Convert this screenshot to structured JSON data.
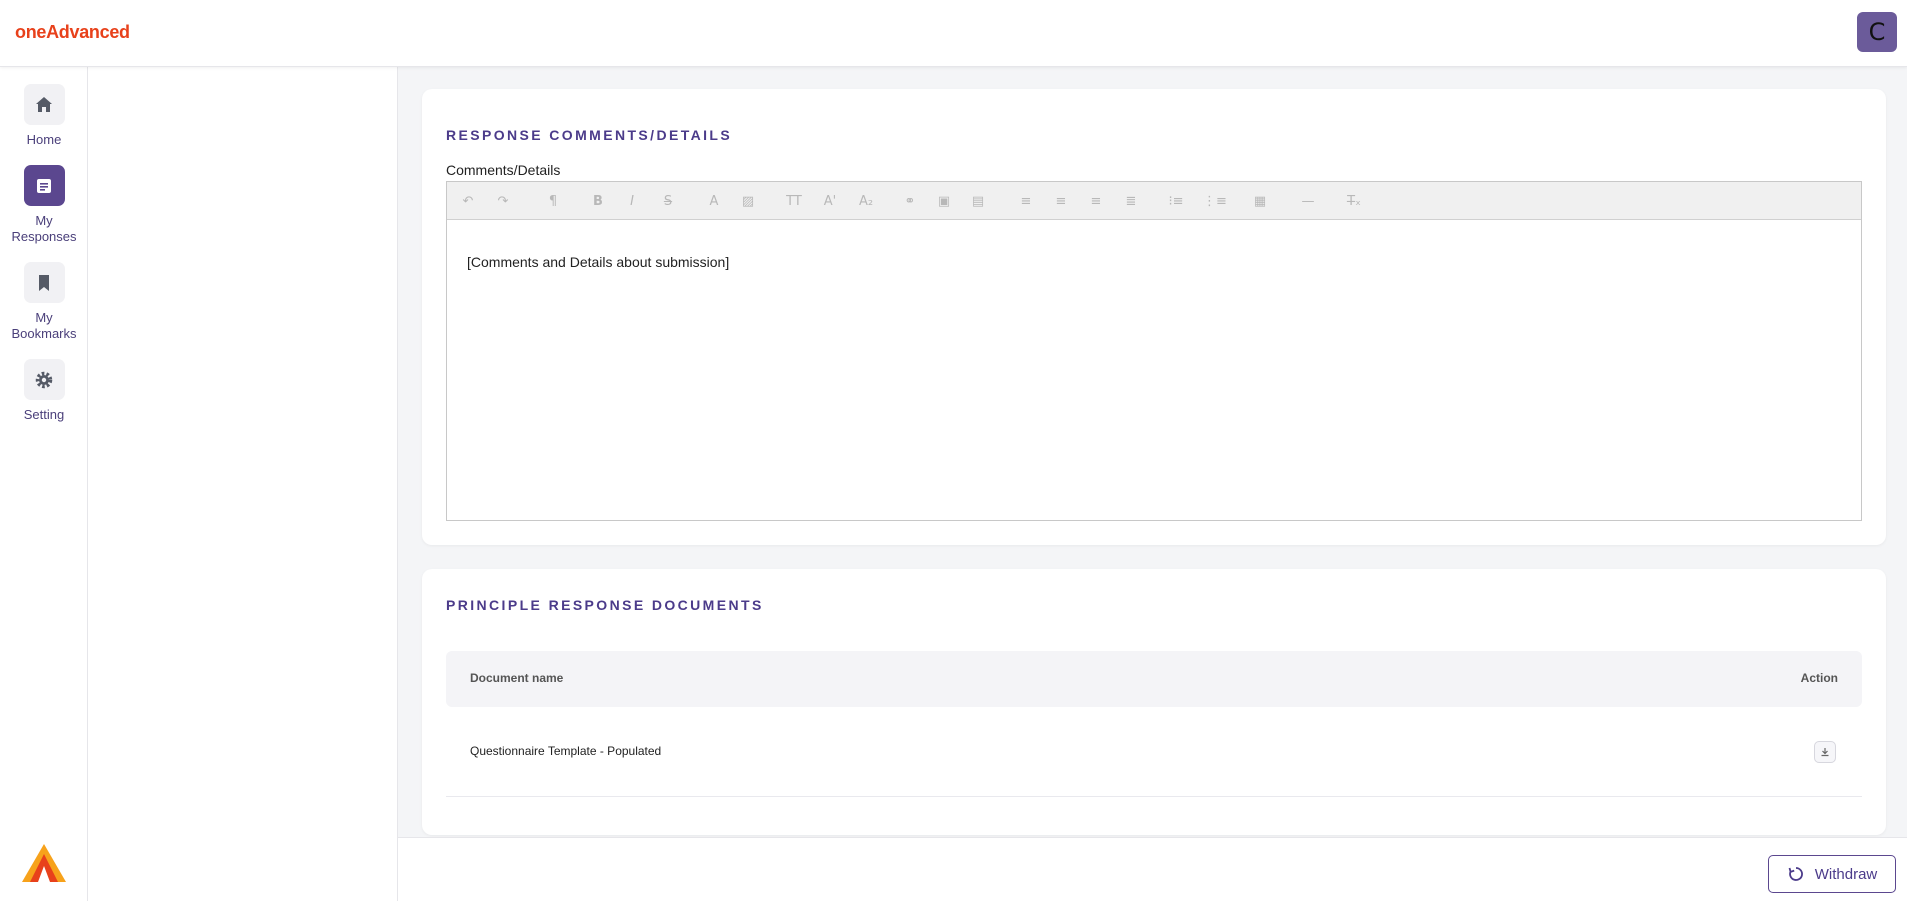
{
  "header": {
    "logo": "oneAdvanced",
    "avatar_initial": "C"
  },
  "nav": {
    "items": [
      {
        "label": "Home",
        "icon": "home-icon",
        "active": false
      },
      {
        "label": "My Responses",
        "icon": "document-icon",
        "active": true
      },
      {
        "label": "My Bookmarks",
        "icon": "bookmark-icon",
        "active": false
      },
      {
        "label": "Setting",
        "icon": "gear-icon",
        "active": false
      }
    ]
  },
  "comments_section": {
    "title": "RESPONSE COMMENTS/DETAILS",
    "field_label": "Comments/Details",
    "editor_content": "[Comments and Details about submission]",
    "toolbar_icons": [
      "undo-icon",
      "redo-icon",
      "paragraph-format-icon",
      "bold-icon",
      "italic-icon",
      "strikethrough-icon",
      "font-color-icon",
      "highlight-color-icon",
      "font-size-icon",
      "superscript-icon",
      "subscript-icon",
      "link-icon",
      "image-icon",
      "embed-icon",
      "align-left-icon",
      "align-center-icon",
      "align-right-icon",
      "justify-icon",
      "bulleted-list-icon",
      "numbered-list-icon",
      "table-icon",
      "horizontal-line-icon",
      "clear-format-icon"
    ]
  },
  "documents_section": {
    "title": "PRINCIPLE RESPONSE DOCUMENTS",
    "columns": {
      "name": "Document name",
      "action": "Action"
    },
    "rows": [
      {
        "name": "Questionnaire Template - Populated",
        "action_icon": "download-icon"
      }
    ]
  },
  "footer": {
    "withdraw_label": "Withdraw"
  },
  "colors": {
    "brand_orange": "#e8411b",
    "accent_purple": "#5b478f",
    "title_purple": "#4b3b8a"
  }
}
